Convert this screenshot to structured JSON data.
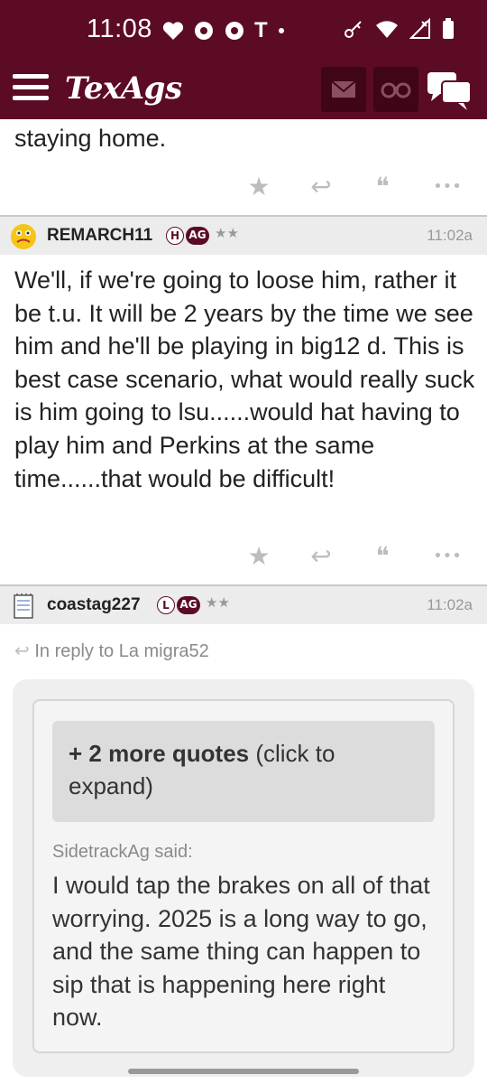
{
  "status_bar": {
    "time": "11:08",
    "left_icons": [
      "heart-icon",
      "chrome-icon",
      "chrome-icon",
      "t-icon",
      "dot-icon"
    ],
    "right_icons": [
      "key-icon",
      "wifi-icon",
      "signal-icon",
      "battery-icon"
    ],
    "t_glyph": "T"
  },
  "app_bar": {
    "logo": "TexAgs",
    "brand_color": "#5c0b25"
  },
  "thread": {
    "previous_post_tail": "staying home.",
    "posts": [
      {
        "username": "REMARCH11",
        "badges": [
          "H",
          "AG"
        ],
        "stars": "★★",
        "time": "11:02a",
        "body": "We'll, if we're going to loose him, rather it be t.u. It will be 2 years by the time we see him and he'll be playing in big12 d. This is best case scenario, what would really suck is him going to lsu......would hat having to play him and Perkins at the same time......that would be difficult!"
      },
      {
        "username": "coastag227",
        "badges": [
          "L",
          "AG"
        ],
        "stars": "★★",
        "time": "11:02a",
        "in_reply_to": "In reply to La migra52",
        "more_quotes_bold": "+ 2 more quotes",
        "more_quotes_rest": " (click to expand)",
        "quote_author": "SidetrackAg said:",
        "quote_text": "I would tap the brakes on all of that worrying. 2025 is a long way to go, and the same thing can happen to sip that is happening here right now."
      }
    ]
  },
  "actions": {
    "star": "★",
    "reply": "↩",
    "quote": "❝",
    "more": "•••"
  }
}
